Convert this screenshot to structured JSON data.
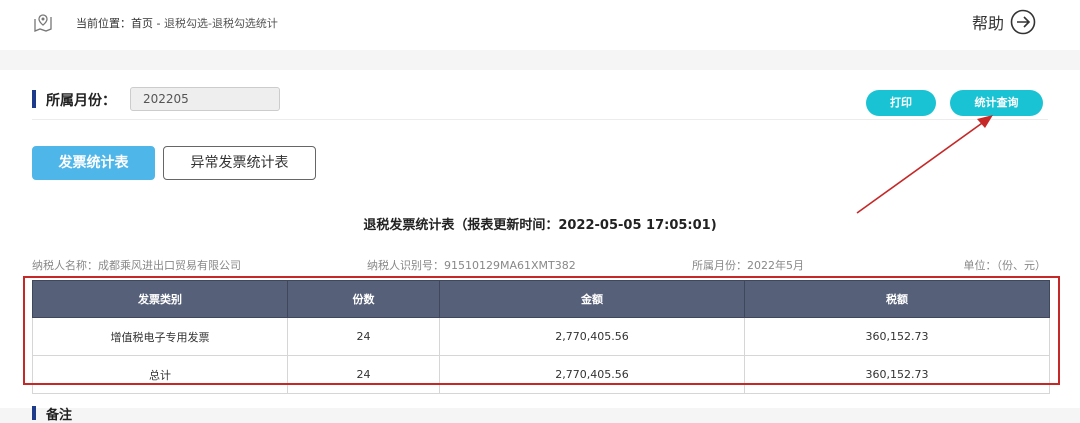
{
  "header": {
    "breadcrumb_prefix": "当前位置：首页 - ",
    "breadcrumb_current": "退税勾选-退税勾选统计",
    "help_label": "帮助"
  },
  "filter": {
    "month_label": "所属月份：",
    "month_value": "202205",
    "print_label": "打印",
    "query_label": "统计查询"
  },
  "tabs": [
    {
      "label": "发票统计表",
      "active": true
    },
    {
      "label": "异常发票统计表",
      "active": false
    }
  ],
  "report": {
    "title": "退税发票统计表（报表更新时间：2022-05-05 17:05:01)",
    "taxpayer_name": "纳税人名称：成都乘风进出口贸易有限公司",
    "taxpayer_id": "纳税人识别号：91510129MA61XMT382",
    "period": "所属月份：2022年5月",
    "unit": "单位：（份、元）"
  },
  "table": {
    "columns": [
      "发票类别",
      "份数",
      "金额",
      "税额"
    ],
    "rows": [
      [
        "增值税电子专用发票",
        "24",
        "2,770,405.56",
        "360,152.73"
      ],
      [
        "总计",
        "24",
        "2,770,405.56",
        "360,152.73"
      ]
    ]
  },
  "remarks": {
    "label": "备注"
  },
  "colors": {
    "accent_teal": "#19c3d4",
    "tab_active": "#4fb6ea",
    "table_header": "#566079",
    "highlight": "#c62828",
    "section_bar": "#1e3a8a"
  },
  "icons": {
    "location": "map-pin-icon",
    "help": "arrow-right-circle-icon"
  }
}
